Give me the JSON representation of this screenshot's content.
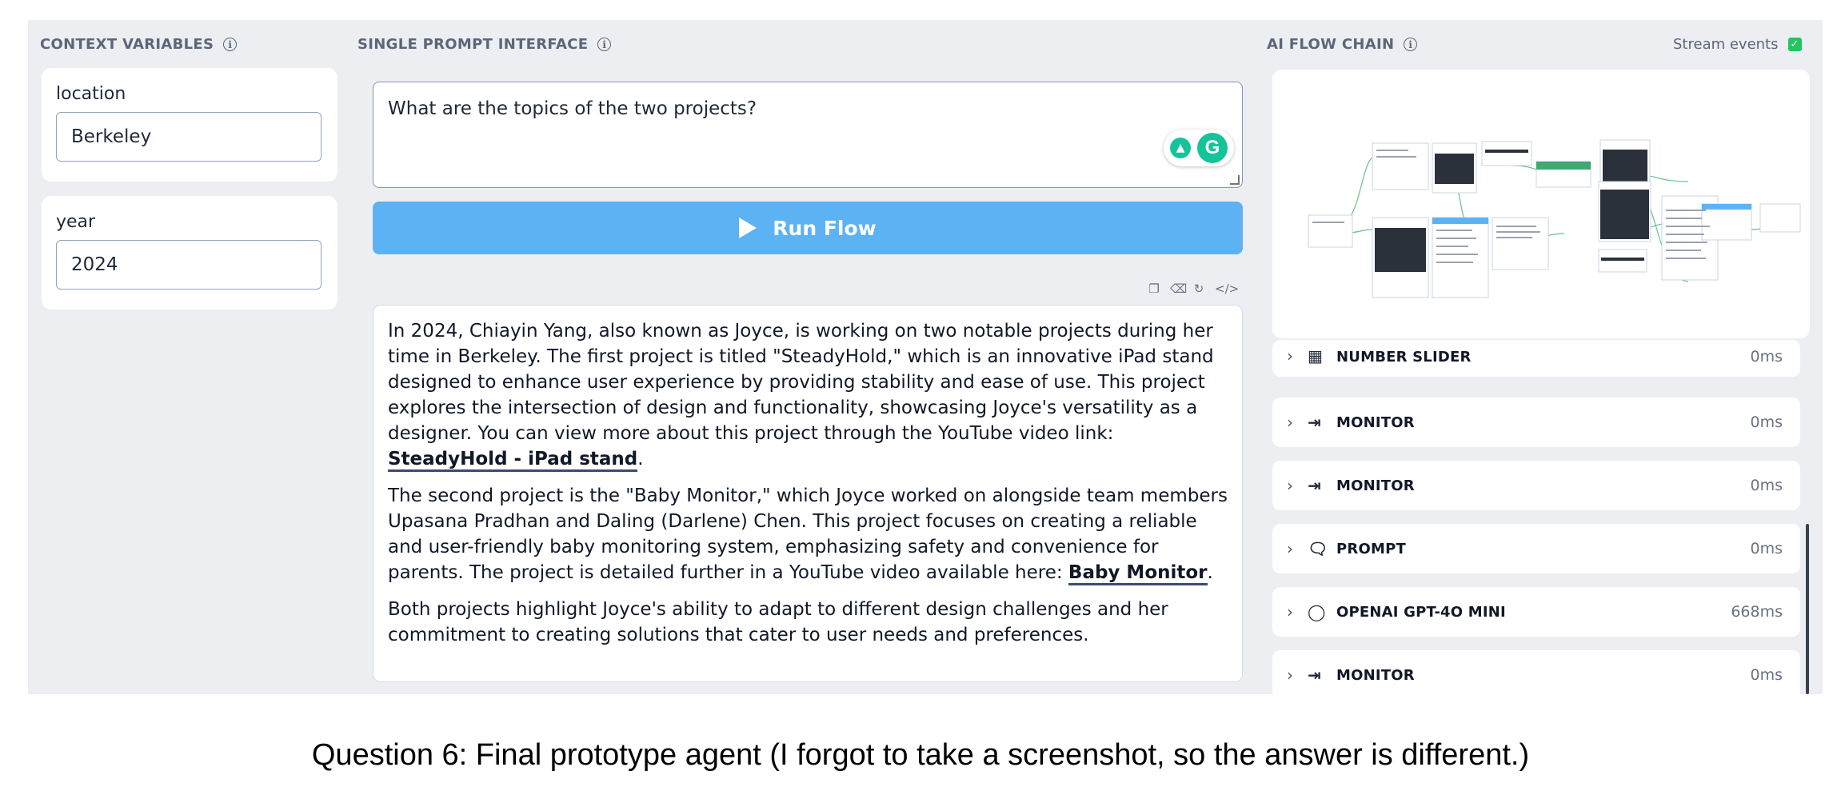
{
  "context_variables": {
    "title": "CONTEXT VARIABLES",
    "variables": [
      {
        "label": "location",
        "value": "Berkeley"
      },
      {
        "label": "year",
        "value": "2024"
      }
    ]
  },
  "prompt_interface": {
    "title": "SINGLE PROMPT INTERFACE",
    "prompt": "What are the topics of the two projects?",
    "run_button": "Run Flow",
    "answer": {
      "p1_text": "In 2024, Chiayin Yang, also known as Joyce, is working on two notable projects during her time in Berkeley. The first project is titled \"SteadyHold,\" which is an innovative iPad stand designed to enhance user experience by providing stability and ease of use. This project explores the intersection of design and functionality, showcasing Joyce's versatility as a designer. You can view more about this project through the YouTube video link: ",
      "p1_link": "SteadyHold - iPad stand",
      "p1_end": ".",
      "p2_text": "The second project is the \"Baby Monitor,\" which Joyce worked on alongside team members Upasana Pradhan and Daling (Darlene) Chen. This project focuses on creating a reliable and user-friendly baby monitoring system, emphasizing safety and convenience for parents. The project is detailed further in a YouTube video available here: ",
      "p2_link": "Baby Monitor",
      "p2_end": ".",
      "p3_text": "Both projects highlight Joyce's ability to adapt to different design challenges and her commitment to creating solutions that cater to user needs and preferences."
    }
  },
  "flow_chain": {
    "title": "AI FLOW CHAIN",
    "stream_label": "Stream events",
    "stream_checked": true,
    "items": [
      {
        "name": "NUMBER SLIDER",
        "time": "0ms",
        "icon": "slider-icon"
      },
      {
        "name": "MONITOR",
        "time": "0ms",
        "icon": "monitor-icon"
      },
      {
        "name": "MONITOR",
        "time": "0ms",
        "icon": "monitor-icon"
      },
      {
        "name": "PROMPT",
        "time": "0ms",
        "icon": "prompt-icon"
      },
      {
        "name": "OPENAI GPT-4O MINI",
        "time": "668ms",
        "icon": "openai-icon"
      },
      {
        "name": "MONITOR",
        "time": "0ms",
        "icon": "monitor-icon"
      }
    ]
  },
  "caption": "Question 6: Final prototype agent (I forgot to take a screenshot, so the answer is different.)",
  "colors": {
    "accent": "#5db2f4",
    "panel_bg": "#eceef2",
    "check": "#22c55e"
  }
}
